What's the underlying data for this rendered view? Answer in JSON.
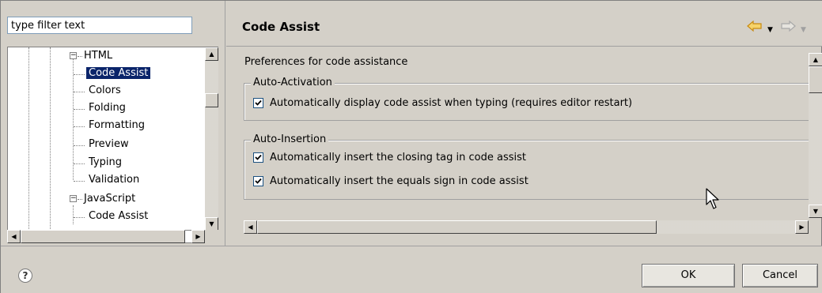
{
  "filter": {
    "value": "type filter text"
  },
  "tree": {
    "items": [
      {
        "label": "HTML",
        "expander": "⊟"
      },
      {
        "label": "Code Assist",
        "selected": true
      },
      {
        "label": "Colors"
      },
      {
        "label": "Folding"
      },
      {
        "label": "Formatting"
      },
      {
        "label": "Preview"
      },
      {
        "label": "Typing"
      },
      {
        "label": "Validation"
      },
      {
        "label": "JavaScript",
        "expander": "⊟"
      },
      {
        "label": "Code Assist"
      }
    ]
  },
  "header": {
    "title": "Code Assist",
    "back_icon": "back-arrow-icon",
    "forward_icon": "forward-arrow-icon"
  },
  "content": {
    "description": "Preferences for code assistance",
    "groups": [
      {
        "title": "Auto-Activation",
        "options": [
          {
            "label": "Automatically display code assist when typing (requires editor restart)",
            "checked": true
          }
        ]
      },
      {
        "title": "Auto-Insertion",
        "options": [
          {
            "label": "Automatically insert the closing tag in code assist",
            "checked": true
          },
          {
            "label": "Automatically insert the equals sign in code assist",
            "checked": true
          }
        ]
      }
    ]
  },
  "buttons": {
    "ok": "OK",
    "cancel": "Cancel",
    "help": "?"
  },
  "colors": {
    "selection": "#0a246a",
    "back_arrow": "#e8a21a",
    "dialog_bg": "#d4d0c8"
  }
}
